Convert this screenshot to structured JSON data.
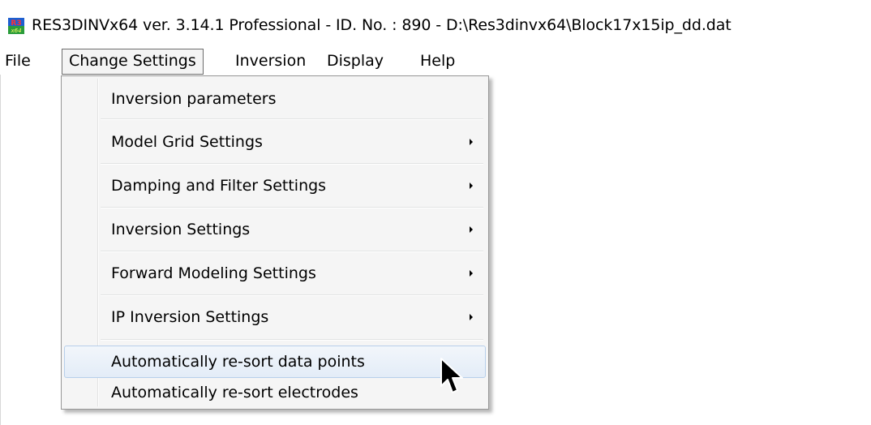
{
  "window": {
    "title": "RES3DINVx64 ver. 3.14.1 Professional - ID. No. : 890  - D:\\Res3dinvx64\\Block17x15ip_dd.dat",
    "icon": "res3dinv-app-icon",
    "icon_text_top": "R3",
    "icon_text_bottom": "x64"
  },
  "menubar": {
    "items": [
      {
        "label": "File"
      },
      {
        "label": "Change Settings"
      },
      {
        "label": "Inversion"
      },
      {
        "label": "Display"
      },
      {
        "label": "Help"
      }
    ]
  },
  "dropdown": {
    "items": [
      {
        "label": "Inversion parameters",
        "submenu": false
      },
      {
        "label": "Model Grid Settings",
        "submenu": true
      },
      {
        "label": "Damping and Filter Settings",
        "submenu": true
      },
      {
        "label": "Inversion Settings",
        "submenu": true
      },
      {
        "label": "Forward Modeling Settings",
        "submenu": true
      },
      {
        "label": "IP Inversion Settings",
        "submenu": true
      },
      {
        "label": "Automatically re-sort data points",
        "submenu": false
      },
      {
        "label": "Automatically re-sort electrodes",
        "submenu": false
      }
    ]
  },
  "colors": {
    "hover_border": "#b7cfea",
    "hover_fill": "#e3ecf7",
    "menu_bg": "#f5f5f5"
  }
}
